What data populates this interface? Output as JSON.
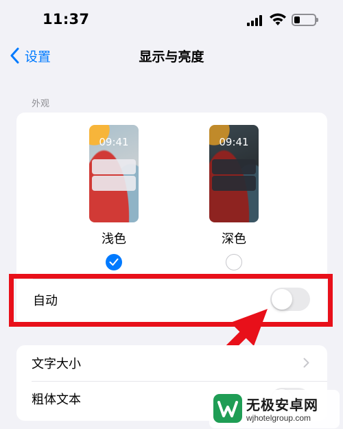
{
  "status_bar": {
    "time": "11:37"
  },
  "nav": {
    "back_label": "设置",
    "title": "显示与亮度"
  },
  "appearance": {
    "section_header": "外观",
    "options": [
      {
        "label": "浅色",
        "preview_time": "09:41",
        "selected": true
      },
      {
        "label": "深色",
        "preview_time": "09:41",
        "selected": false
      }
    ],
    "auto_label": "自动",
    "auto_enabled": false
  },
  "text_settings": {
    "text_size_label": "文字大小",
    "bold_text_label": "粗体文本",
    "bold_text_enabled": false
  },
  "watermark": {
    "title": "无极安卓网",
    "url": "wjhotelgroup.com"
  },
  "colors": {
    "accent": "#007aff",
    "background": "#f2f2f7",
    "highlight": "#e8101a",
    "toggle_off": "#e9e9eb"
  }
}
